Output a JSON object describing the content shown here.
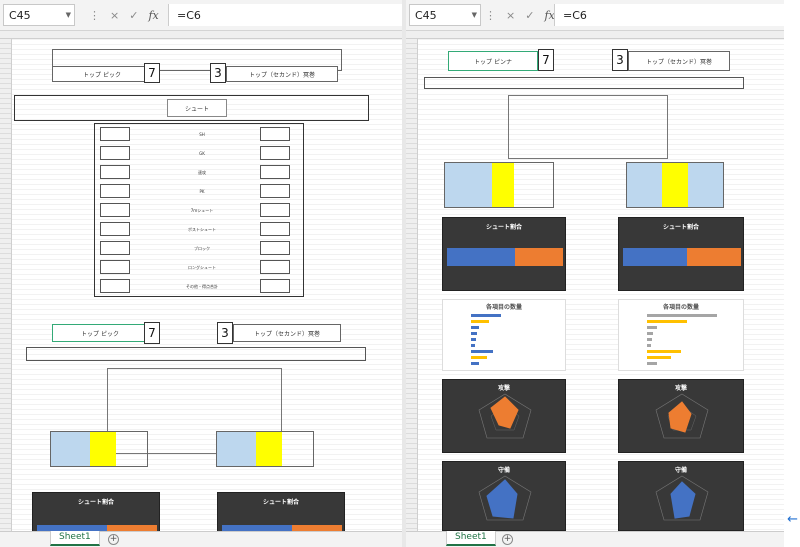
{
  "left_window": {
    "name_box": "C45",
    "formula": "=C6",
    "sheet_tab": "Sheet1",
    "team_left": "トップ ピック",
    "score_left": "7",
    "score_right": "3",
    "team_right": "トップ（セカンド）冥巻",
    "shoot_label": "シュート",
    "rows": [
      "SH",
      "GK",
      "速攻",
      "PK",
      "7ｍシュート",
      "ポストシュート",
      "ブロック",
      "ロングシュート",
      "その他・得点合計"
    ],
    "chart_title_shoot": "シュート割合"
  },
  "right_window": {
    "name_box": "C45",
    "formula": "=C6",
    "sheet_tab": "Sheet1",
    "team_left": "トップ ピンナ",
    "score_left": "7",
    "score_right": "3",
    "team_right": "トップ（セカンド）冥巻",
    "chart_title_shoot_1": "シュート割合",
    "chart_title_shoot_2": "シュート割合",
    "chart_title_counts_1": "各項目の数量",
    "chart_title_counts_2": "各項目の数量",
    "chart_title_attack_1": "攻撃",
    "chart_title_attack_2": "攻撃",
    "chart_title_defense_1": "守備",
    "chart_title_defense_2": "守備"
  },
  "icons": {
    "cancel": "×",
    "confirm": "✓",
    "function": "fx",
    "add_sheet": "+",
    "collapse": "←"
  },
  "colors": {
    "chart_blue": "#4472c4",
    "chart_orange": "#ed7d31",
    "highlight_yellow": "#ffff00",
    "highlight_blue": "#bdd7ee",
    "tab_green": "#217346"
  }
}
